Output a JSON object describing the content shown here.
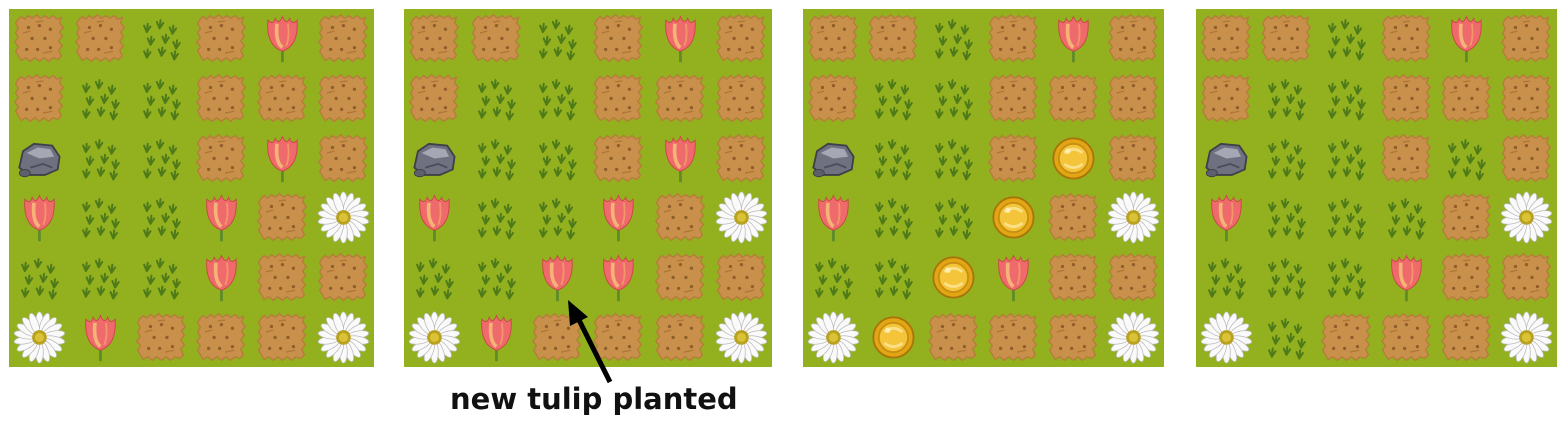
{
  "caption": "new tulip planted",
  "panels": [
    {
      "id": "before",
      "grid": [
        [
          "dirt",
          "dirt",
          "grass",
          "dirt",
          "tulip",
          "dirt"
        ],
        [
          "dirt",
          "grass",
          "grass",
          "dirt",
          "dirt",
          "dirt"
        ],
        [
          "rock",
          "grass",
          "grass",
          "dirt",
          "tulip",
          "dirt"
        ],
        [
          "tulip",
          "grass",
          "grass",
          "tulip",
          "dirt",
          "daisy"
        ],
        [
          "grass",
          "grass",
          "grass",
          "tulip",
          "dirt",
          "dirt"
        ],
        [
          "daisy",
          "tulip",
          "dirt",
          "dirt",
          "dirt",
          "daisy"
        ]
      ]
    },
    {
      "id": "planted",
      "grid": [
        [
          "dirt",
          "dirt",
          "grass",
          "dirt",
          "tulip",
          "dirt"
        ],
        [
          "dirt",
          "grass",
          "grass",
          "dirt",
          "dirt",
          "dirt"
        ],
        [
          "rock",
          "grass",
          "grass",
          "dirt",
          "tulip",
          "dirt"
        ],
        [
          "tulip",
          "grass",
          "grass",
          "tulip",
          "dirt",
          "daisy"
        ],
        [
          "grass",
          "grass",
          "tulip",
          "tulip",
          "dirt",
          "dirt"
        ],
        [
          "daisy",
          "tulip",
          "dirt",
          "dirt",
          "dirt",
          "daisy"
        ]
      ]
    },
    {
      "id": "matched",
      "grid": [
        [
          "dirt",
          "dirt",
          "grass",
          "dirt",
          "tulip",
          "dirt"
        ],
        [
          "dirt",
          "grass",
          "grass",
          "dirt",
          "dirt",
          "dirt"
        ],
        [
          "rock",
          "grass",
          "grass",
          "dirt",
          "coin",
          "dirt"
        ],
        [
          "tulip",
          "grass",
          "grass",
          "coin",
          "dirt",
          "daisy"
        ],
        [
          "grass",
          "grass",
          "coin",
          "tulip",
          "dirt",
          "dirt"
        ],
        [
          "daisy",
          "coin",
          "dirt",
          "dirt",
          "dirt",
          "daisy"
        ]
      ]
    },
    {
      "id": "after",
      "grid": [
        [
          "dirt",
          "dirt",
          "grass",
          "dirt",
          "tulip",
          "dirt"
        ],
        [
          "dirt",
          "grass",
          "grass",
          "dirt",
          "dirt",
          "dirt"
        ],
        [
          "rock",
          "grass",
          "grass",
          "dirt",
          "grass",
          "dirt"
        ],
        [
          "tulip",
          "grass",
          "grass",
          "grass",
          "dirt",
          "daisy"
        ],
        [
          "grass",
          "grass",
          "grass",
          "tulip",
          "dirt",
          "dirt"
        ],
        [
          "daisy",
          "grass",
          "dirt",
          "dirt",
          "dirt",
          "daisy"
        ]
      ]
    }
  ]
}
